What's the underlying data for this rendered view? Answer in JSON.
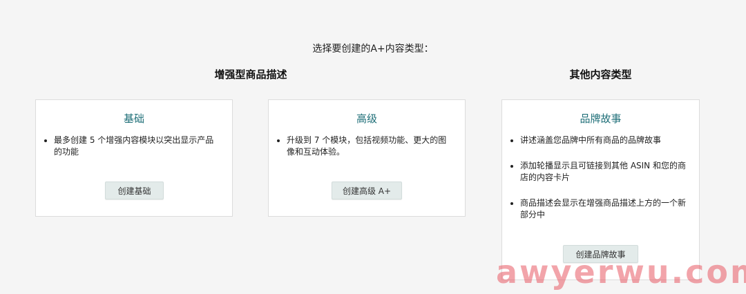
{
  "page": {
    "prompt": "选择要创建的A+内容类型："
  },
  "groups": {
    "enhanced_title": "增强型商品描述",
    "other_title": "其他内容类型"
  },
  "cards": {
    "basic": {
      "title": "基础",
      "bullets": [
        "最多创建 5 个增强内容模块以突出显示产品的功能"
      ],
      "button": "创建基础"
    },
    "premium": {
      "title": "高级",
      "bullets": [
        "升级到 7 个模块，包括视频功能、更大的图像和互动体验。"
      ],
      "button": "创建高级 A+"
    },
    "brand_story": {
      "title": "品牌故事",
      "bullets": [
        "讲述涵盖您品牌中所有商品的品牌故事",
        "添加轮播显示且可链接到其他 ASIN 和您的商店的内容卡片",
        "商品描述会显示在增强商品描述上方的一个新部分中"
      ],
      "button": "创建品牌故事"
    }
  },
  "watermark": "awyerwu.com",
  "colors": {
    "background": "#f5f5f5",
    "card_title": "#1f6f78",
    "button_bg": "#e3ebea",
    "watermark": "#e85a64"
  }
}
